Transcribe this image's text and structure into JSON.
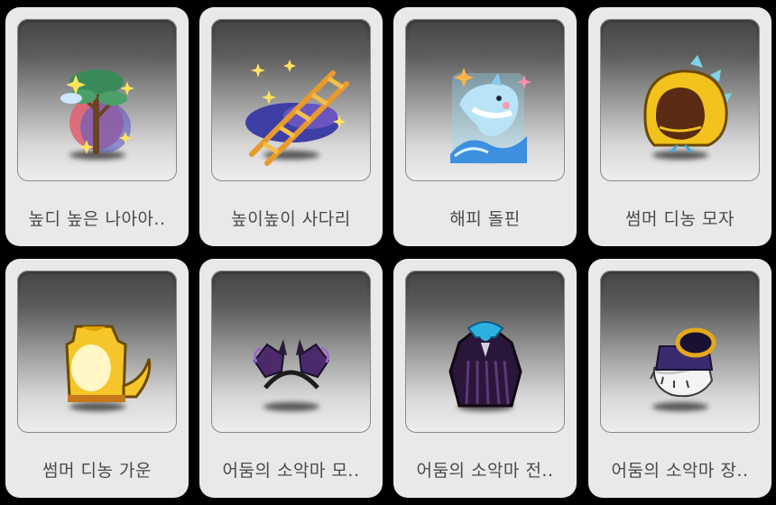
{
  "items": [
    {
      "label": "높디 높은 나아아..",
      "icon": "tree-icon"
    },
    {
      "label": "높이높이 사다리",
      "icon": "ladder-icon"
    },
    {
      "label": "해피 돌핀",
      "icon": "dolphin-icon"
    },
    {
      "label": "썸머 디농 모자",
      "icon": "dino-hat-icon"
    },
    {
      "label": "썸머 디농 가운",
      "icon": "dino-gown-icon"
    },
    {
      "label": "어둠의 소악마 모..",
      "icon": "devil-headband-icon"
    },
    {
      "label": "어둠의 소악마 전..",
      "icon": "devil-outfit-icon"
    },
    {
      "label": "어둠의 소악마 장..",
      "icon": "devil-glove-icon"
    }
  ]
}
